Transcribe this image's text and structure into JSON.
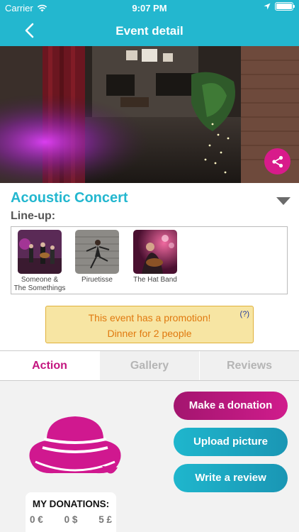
{
  "status_bar": {
    "carrier": "Carrier",
    "time": "9:07 PM",
    "battery_level": 1.0
  },
  "nav": {
    "title": "Event detail",
    "back_icon": "chevron-left-icon"
  },
  "hero": {
    "share_icon": "share-icon"
  },
  "event": {
    "title": "Acoustic Concert",
    "lineup_label": "Line-up:",
    "bands": [
      {
        "name_line1": "Someone &",
        "name_line2": "The Somethings"
      },
      {
        "name_line1": "Piruetisse",
        "name_line2": ""
      },
      {
        "name_line1": "The Hat Band",
        "name_line2": ""
      }
    ]
  },
  "promotion": {
    "line1": "This event has a promotion!",
    "line2": "Dinner for 2 people",
    "help": "(?)"
  },
  "tabs": [
    {
      "label": "Action",
      "active": true
    },
    {
      "label": "Gallery",
      "active": false
    },
    {
      "label": "Reviews",
      "active": false
    }
  ],
  "actions": {
    "donate": "Make a donation",
    "upload": "Upload picture",
    "review": "Write a review"
  },
  "donations": {
    "label": "MY DONATIONS:",
    "euro": "0 €",
    "dollar": "0 $",
    "pound": "5 £"
  },
  "colors": {
    "primary": "#23b7cf",
    "accent": "#c3157f",
    "promo_bg": "#f7e5a3",
    "promo_text": "#e0790f"
  }
}
